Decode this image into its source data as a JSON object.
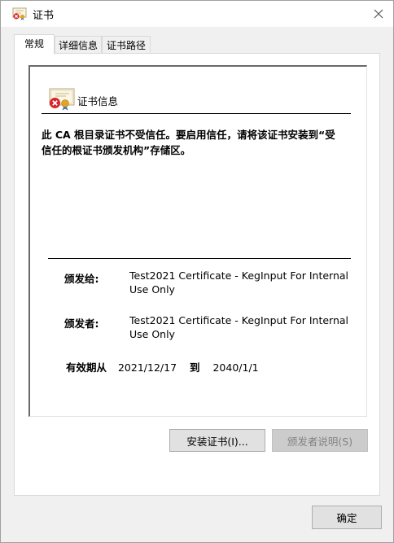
{
  "window": {
    "title": "证书"
  },
  "tabs": [
    {
      "label": "常规"
    },
    {
      "label": "详细信息"
    },
    {
      "label": "证书路径"
    }
  ],
  "general": {
    "section_title": "证书信息",
    "warning": "此 CA 根目录证书不受信任。要启用信任，请将该证书安装到“受信任的根证书颁发机构”存储区。",
    "issued_to_label": "颁发给:",
    "issued_to_value": "Test2021 Certificate - KegInput For Internal Use Only",
    "issued_by_label": "颁发者:",
    "issued_by_value": "Test2021 Certificate - KegInput For Internal Use Only",
    "validity_label": "有效期从",
    "valid_from": "2021/12/17",
    "validity_to": "到",
    "valid_to": "2040/1/1"
  },
  "buttons": {
    "install": "安装证书(I)...",
    "issuer_statement": "颁发者说明(S)",
    "ok": "确定"
  },
  "icons": {
    "app": "certificate-icon",
    "close": "close-icon",
    "cert_info": "certificate-error-icon"
  }
}
